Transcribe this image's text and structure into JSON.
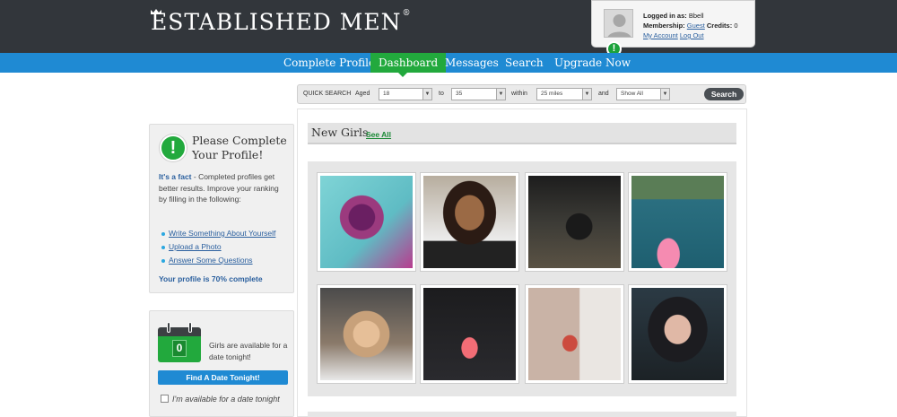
{
  "header": {
    "logo_text": "ESTABLISHED MEN",
    "logo_reg": "®",
    "account": {
      "logged_in_label": "Logged in as:",
      "username": "Bbell",
      "membership_label": "Membership:",
      "membership_value": "Guest",
      "credits_label": "Credits:",
      "credits_value": "0",
      "my_account": "My Account",
      "logout": "Log Out"
    },
    "alert_badge": "!"
  },
  "nav": {
    "items": [
      "Complete Profile!",
      "Dashboard",
      "Messages",
      "Search",
      "Upgrade Now"
    ],
    "active": "Dashboard"
  },
  "quick_search": {
    "title": "QUICK SEARCH",
    "aged_label": "Aged",
    "age_from": "18",
    "to_label": "to",
    "age_to": "35",
    "within_label": "within",
    "distance": "25 miles",
    "and_label": "and",
    "show": "Show All",
    "button": "Search"
  },
  "profile_card": {
    "title": "Please Complete Your Profile!",
    "fact_label": "It's a fact",
    "body": " - Completed profiles get better results. Improve your ranking by filling in the following:",
    "links": [
      "Write Something About Yourself",
      "Upload a Photo",
      "Answer Some Questions"
    ],
    "complete_text": "Your profile is 70% complete",
    "profile_complete_pct": 70
  },
  "date_card": {
    "count": "0",
    "text": "Girls are available for a date tonight!",
    "button": "Find A Date Tonight!",
    "checkbox_label": "I'm available for a date tonight",
    "checked": false
  },
  "new_girls": {
    "title": "New Girls",
    "see_all": "See All",
    "photos": [
      {
        "name": "photo-1"
      },
      {
        "name": "photo-2"
      },
      {
        "name": "photo-3"
      },
      {
        "name": "photo-4"
      },
      {
        "name": "photo-5"
      },
      {
        "name": "photo-6"
      },
      {
        "name": "photo-7"
      },
      {
        "name": "photo-8"
      }
    ]
  },
  "colors": {
    "header_bg": "#32363b",
    "nav_bg": "#1f8ad3",
    "accent_green": "#22a93d",
    "link_blue": "#2a5f9e"
  }
}
